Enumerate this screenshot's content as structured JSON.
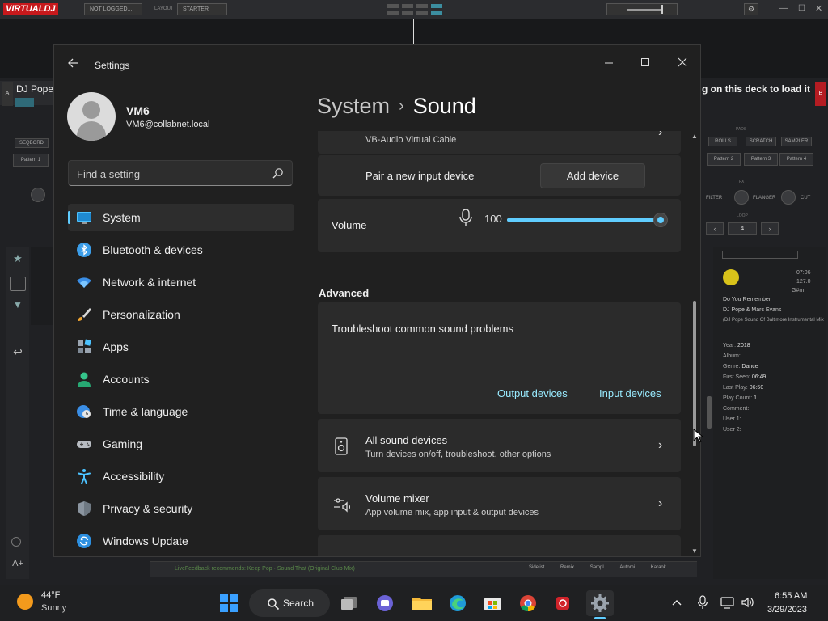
{
  "virtualdj": {
    "logo": "VIRTUALDJ",
    "login_status": "NOT LOGGED...",
    "layout_label": "LAYOUT",
    "layout_value": "STARTER",
    "deck_a_label": "A",
    "deck_a_title": "DJ Pope",
    "deck_b_label": "B",
    "deck_b_message": "g on this deck to load it",
    "seqbord": "SEQBORD",
    "pattern_left": "Pattern 1",
    "pads_label": "PADS",
    "pad_modes": [
      "ROLLS",
      "SCRATCH",
      "SAMPLER"
    ],
    "patterns_right": [
      "Pattern 2",
      "Pattern 3",
      "Pattern 4"
    ],
    "fx_label": "FX",
    "fx_items": [
      "FILTER",
      "FLANGER",
      "CUT"
    ],
    "loop_label": "LOOP",
    "loop_value": "4",
    "track_time": "07:06",
    "track_bpm": "127.0",
    "track_key": "G#m",
    "track_title": "Do You Remember",
    "track_artist": "DJ Pope & Marc Evans",
    "track_remix": "(DJ Pope Sound Of Baltimore Instrumental Mix",
    "info": [
      {
        "label": "Year:",
        "value": "2018"
      },
      {
        "label": "Album:",
        "value": ""
      },
      {
        "label": "Genre:",
        "value": "Dance"
      },
      {
        "label": "First Seen:",
        "value": "06:49"
      },
      {
        "label": "Last Play:",
        "value": "06:50"
      },
      {
        "label": "Play Count:",
        "value": "1"
      },
      {
        "label": "Comment:",
        "value": ""
      },
      {
        "label": "User 1:",
        "value": ""
      },
      {
        "label": "User 2:",
        "value": ""
      }
    ],
    "live_feedback": "LiveFeedback recommends: Keep Pop · Sound That (Original Club Mix)",
    "bottom_tabs": [
      "Sidelist",
      "Remix",
      "Sampl",
      "Automi",
      "Karaok"
    ]
  },
  "settings": {
    "window_title": "Settings",
    "user": {
      "name": "VM6",
      "email": "VM6@collabnet.local"
    },
    "search_placeholder": "Find a setting",
    "nav": [
      {
        "label": "System",
        "icon": "monitor-icon",
        "selected": true
      },
      {
        "label": "Bluetooth & devices",
        "icon": "bluetooth-icon"
      },
      {
        "label": "Network & internet",
        "icon": "wifi-icon"
      },
      {
        "label": "Personalization",
        "icon": "brush-icon"
      },
      {
        "label": "Apps",
        "icon": "apps-icon"
      },
      {
        "label": "Accounts",
        "icon": "person-icon"
      },
      {
        "label": "Time & language",
        "icon": "globe-clock-icon"
      },
      {
        "label": "Gaming",
        "icon": "gamepad-icon"
      },
      {
        "label": "Accessibility",
        "icon": "accessibility-icon"
      },
      {
        "label": "Privacy & security",
        "icon": "shield-icon"
      },
      {
        "label": "Windows Update",
        "icon": "update-icon"
      }
    ],
    "breadcrumb": {
      "parent": "System",
      "separator": "›",
      "current": "Sound"
    },
    "input_device_sub": "VB-Audio Virtual Cable",
    "pair_label": "Pair a new input device",
    "add_device_label": "Add device",
    "volume": {
      "label": "Volume",
      "value": "100",
      "level": 100
    },
    "advanced_heading": "Advanced",
    "troubleshoot": {
      "title": "Troubleshoot common sound problems",
      "output_link": "Output devices",
      "input_link": "Input devices"
    },
    "all_devices": {
      "title": "All sound devices",
      "sub": "Turn devices on/off, troubleshoot, other options"
    },
    "mixer": {
      "title": "Volume mixer",
      "sub": "App volume mix, app input & output devices"
    }
  },
  "taskbar": {
    "weather_temp": "44°F",
    "weather_desc": "Sunny",
    "search_label": "Search",
    "time": "6:55 AM",
    "date": "3/29/2023"
  },
  "colors": {
    "accent": "#60cdff",
    "window_bg": "#202020",
    "card_bg": "#2b2b2b",
    "link": "#99ebff"
  }
}
